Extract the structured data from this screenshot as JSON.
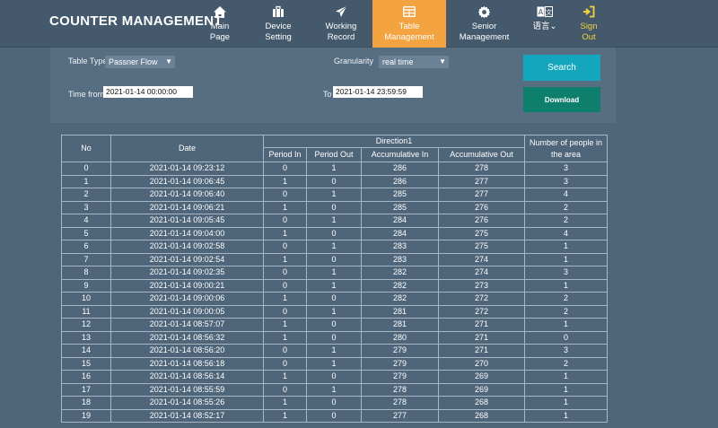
{
  "header": {
    "brand": "COUNTER MANAGEMENT",
    "nav": [
      {
        "line1": "Main",
        "line2": "Page",
        "icon": "home-icon"
      },
      {
        "line1": "Device",
        "line2": "Setting",
        "icon": "briefcase-icon"
      },
      {
        "line1": "Working",
        "line2": "Record",
        "icon": "paper-plane-icon"
      },
      {
        "line1": "Table",
        "line2": "Management",
        "icon": "table-icon"
      },
      {
        "line1": "Senior",
        "line2": "Management",
        "icon": "gear-icon"
      },
      {
        "line1": "语言",
        "line2": "",
        "icon": "translate-icon"
      },
      {
        "line1": "Sign",
        "line2": "Out",
        "icon": "sign-out-icon"
      }
    ],
    "active_color": "#f3a33f"
  },
  "filter": {
    "table_type_label": "Table Type",
    "table_type_value": "Passner Flow",
    "granularity_label": "Granularity",
    "granularity_value": "real time",
    "time_from_label": "Time from",
    "time_from_value": "2021-01-14 00:00:00",
    "to_label": "To",
    "to_value": "2021-01-14 23:59:59",
    "search_label": "Search",
    "download_label": "Download"
  },
  "table": {
    "col_no": "No",
    "col_date": "Date",
    "col_direction": "Direction1",
    "col_period_in": "Period In",
    "col_period_out": "Period Out",
    "col_accum_in": "Accumulative In",
    "col_accum_out": "Accumulative Out",
    "col_people_line1": "Number of people in",
    "col_people_line2": "the area",
    "rows": [
      [
        "0",
        "2021-01-14 09:23:12",
        "0",
        "1",
        "286",
        "278",
        "3"
      ],
      [
        "1",
        "2021-01-14 09:06:45",
        "1",
        "0",
        "286",
        "277",
        "3"
      ],
      [
        "2",
        "2021-01-14 09:06:40",
        "0",
        "1",
        "285",
        "277",
        "4"
      ],
      [
        "3",
        "2021-01-14 09:06:21",
        "1",
        "0",
        "285",
        "276",
        "2"
      ],
      [
        "4",
        "2021-01-14 09:05:45",
        "0",
        "1",
        "284",
        "276",
        "2"
      ],
      [
        "5",
        "2021-01-14 09:04:00",
        "1",
        "0",
        "284",
        "275",
        "4"
      ],
      [
        "6",
        "2021-01-14 09:02:58",
        "0",
        "1",
        "283",
        "275",
        "1"
      ],
      [
        "7",
        "2021-01-14 09:02:54",
        "1",
        "0",
        "283",
        "274",
        "1"
      ],
      [
        "8",
        "2021-01-14 09:02:35",
        "0",
        "1",
        "282",
        "274",
        "3"
      ],
      [
        "9",
        "2021-01-14 09:00:21",
        "0",
        "1",
        "282",
        "273",
        "1"
      ],
      [
        "10",
        "2021-01-14 09:00:06",
        "1",
        "0",
        "282",
        "272",
        "2"
      ],
      [
        "11",
        "2021-01-14 09:00:05",
        "0",
        "1",
        "281",
        "272",
        "2"
      ],
      [
        "12",
        "2021-01-14 08:57:07",
        "1",
        "0",
        "281",
        "271",
        "1"
      ],
      [
        "13",
        "2021-01-14 08:56:32",
        "1",
        "0",
        "280",
        "271",
        "0"
      ],
      [
        "14",
        "2021-01-14 08:56:20",
        "0",
        "1",
        "279",
        "271",
        "3"
      ],
      [
        "15",
        "2021-01-14 08:56:18",
        "0",
        "1",
        "279",
        "270",
        "2"
      ],
      [
        "16",
        "2021-01-14 08:56:14",
        "1",
        "0",
        "279",
        "269",
        "1"
      ],
      [
        "17",
        "2021-01-14 08:55:59",
        "0",
        "1",
        "278",
        "269",
        "1"
      ],
      [
        "18",
        "2021-01-14 08:55:26",
        "1",
        "0",
        "278",
        "268",
        "1"
      ],
      [
        "19",
        "2021-01-14 08:52:17",
        "1",
        "0",
        "277",
        "268",
        "1"
      ]
    ]
  }
}
